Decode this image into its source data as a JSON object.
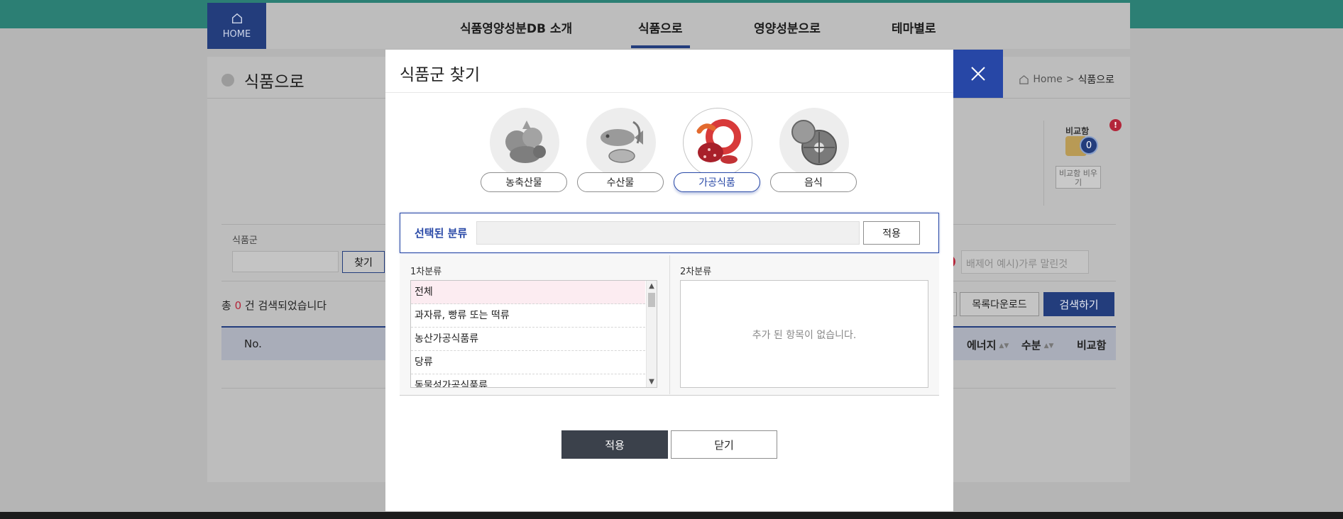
{
  "header": {
    "home_label": "HOME",
    "nav": [
      "식품영양성분DB 소개",
      "식품으로",
      "영양성분으로",
      "테마별로"
    ]
  },
  "page": {
    "title": "식품으로",
    "breadcrumb_home": "Home",
    "breadcrumb_sep": ">",
    "breadcrumb_current": "식품으로"
  },
  "compare": {
    "label": "비교함",
    "count": "0",
    "alert": "!",
    "clear_label": "비교함 비우기"
  },
  "search": {
    "food_group_label": "식품군",
    "find_button": "찾기",
    "exclude_placeholder": "배제어 예시)가루 말린것"
  },
  "results": {
    "prefix": "총",
    "count": "0",
    "suffix": "건 검색되었습니다",
    "download_button": "목록다운로드",
    "search_button": "검색하기",
    "columns": {
      "no": "No.",
      "energy": "에너지",
      "water": "수분",
      "compare": "비교함"
    },
    "sort_glyph": "▲▼"
  },
  "modal": {
    "title": "식품군 찾기",
    "categories": [
      "농축산물",
      "수산물",
      "가공식품",
      "음식"
    ],
    "active_category": "가공식품",
    "selected_label": "선택된 분류",
    "selected_value": "",
    "selected_apply": "적용",
    "list1_header": "1차분류",
    "list2_header": "2차분류",
    "list1_items": [
      "전체",
      "과자류, 빵류 또는 떡류",
      "농산가공식품류",
      "당류",
      "동물성가공식품류"
    ],
    "list2_empty": "추가 된 항목이 없습니다.",
    "apply_button": "적용",
    "close_button": "닫기"
  },
  "colors": {
    "brand_blue": "#2747a6",
    "nav_dark": "#233d7c",
    "teal": "#2c7f74",
    "alert_red": "#b3263a",
    "apply_dark": "#3b414b"
  }
}
